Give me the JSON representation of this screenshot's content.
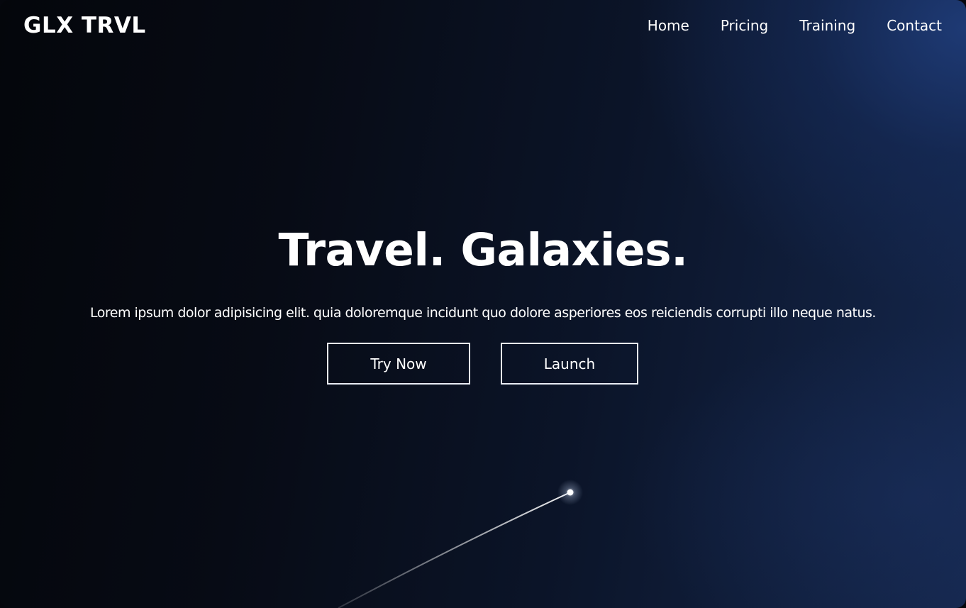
{
  "nav": {
    "logo": "GLX TRVL",
    "links": [
      "Home",
      "Pricing",
      "Training",
      "Contact"
    ]
  },
  "hero": {
    "title": "Travel. Galaxies.",
    "subtitle": "Lorem ipsum dolor adipisicing elit. quia doloremque incidunt quo dolore asperiores eos reiciendis corrupti illo neque natus.",
    "primary_button": "Try Now",
    "secondary_button": "Launch"
  },
  "colors": {
    "background_dark": "#05070d",
    "background_accent": "#1a3060",
    "text": "#ffffff",
    "button_border": "#e8ecf4"
  }
}
